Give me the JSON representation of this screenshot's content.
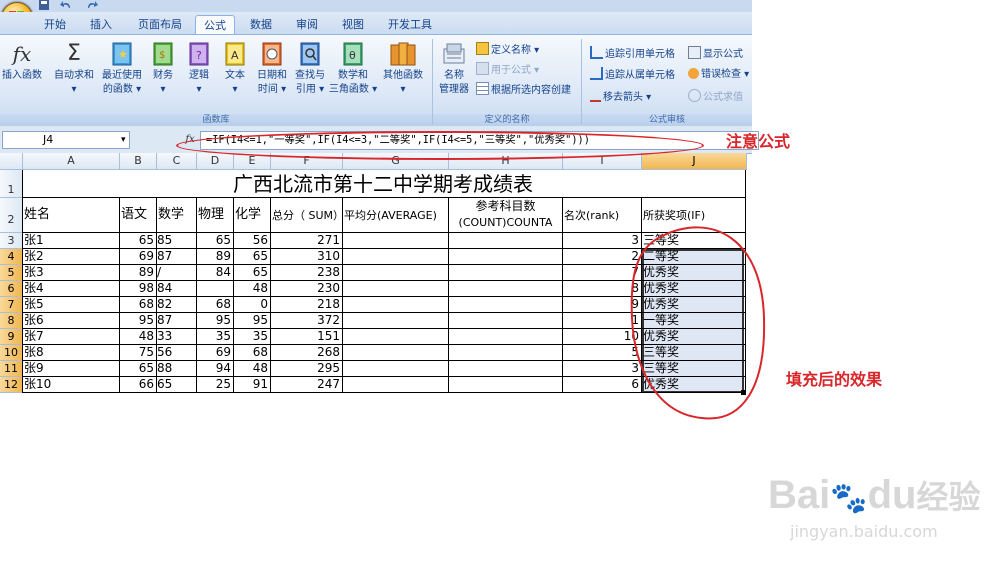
{
  "ribbon_tabs": [
    "开始",
    "插入",
    "页面布局",
    "公式",
    "数据",
    "审阅",
    "视图",
    "开发工具"
  ],
  "active_tab": "公式",
  "function_library": {
    "label": "函数库",
    "buttons": [
      {
        "line1": "插入函数",
        "line2": ""
      },
      {
        "line1": "自动求和",
        "line2": ""
      },
      {
        "line1": "最近使用",
        "line2": "的函数"
      },
      {
        "line1": "财务",
        "line2": ""
      },
      {
        "line1": "逻辑",
        "line2": ""
      },
      {
        "line1": "文本",
        "line2": ""
      },
      {
        "line1": "日期和",
        "line2": "时间"
      },
      {
        "line1": "查找与",
        "line2": "引用"
      },
      {
        "line1": "数学和",
        "line2": "三角函数"
      },
      {
        "line1": "其他函数",
        "line2": ""
      }
    ]
  },
  "defined_names": {
    "label": "定义的名称",
    "manager_line1": "名称",
    "manager_line2": "管理器",
    "define_name": "定义名称",
    "use_in_formula": "用于公式",
    "create_from_selection": "根据所选内容创建"
  },
  "formula_auditing": {
    "label": "公式审核",
    "trace_precedents": "追踪引用单元格",
    "trace_dependents": "追踪从属单元格",
    "remove_arrows": "移去箭头",
    "show_formulas": "显示公式",
    "error_checking": "错误检查",
    "evaluate_formula": "公式求值"
  },
  "name_box": "J4",
  "fx_label": "fx",
  "formula": "=IF(I4<=1,\"一等奖\",IF(I4<=3,\"二等奖\",IF(I4<=5,\"三等奖\",\"优秀奖\")))",
  "columns": [
    "A",
    "B",
    "C",
    "D",
    "E",
    "F",
    "G",
    "H",
    "I",
    "J"
  ],
  "selected_column": "J",
  "sheet": {
    "title": "广西北流市第十二中学期考成绩表",
    "headers": {
      "name": "姓名",
      "chinese": "语文",
      "math": "数学",
      "physics": "物理",
      "chemistry": "化学",
      "total": "总分（ SUM）",
      "average": "平均分(AVERAGE)",
      "subjects_line1": "参考科目数",
      "subjects_line2": "(COUNT)COUNTA",
      "rank": "名次(rank)",
      "award": "所获奖项(IF)"
    },
    "rows": [
      {
        "row": "3",
        "name": "张1",
        "b": "65",
        "c": "85",
        "d": "65",
        "e": "56",
        "f": "271",
        "i": "3",
        "j": "三等奖"
      },
      {
        "row": "4",
        "name": "张2",
        "b": "69",
        "c": "87",
        "d": "89",
        "e": "65",
        "f": "310",
        "i": "2",
        "j": "二等奖"
      },
      {
        "row": "5",
        "name": "张3",
        "b": "89",
        "c": "/",
        "d": "84",
        "e": "65",
        "f": "238",
        "i": "7",
        "j": "优秀奖"
      },
      {
        "row": "6",
        "name": "张4",
        "b": "98",
        "c": "84",
        "d": "",
        "e": "48",
        "f": "230",
        "i": "8",
        "j": "优秀奖"
      },
      {
        "row": "7",
        "name": "张5",
        "b": "68",
        "c": "82",
        "d": "68",
        "e": "0",
        "f": "218",
        "i": "9",
        "j": "优秀奖"
      },
      {
        "row": "8",
        "name": "张6",
        "b": "95",
        "c": "87",
        "d": "95",
        "e": "95",
        "f": "372",
        "i": "1",
        "j": "一等奖"
      },
      {
        "row": "9",
        "name": "张7",
        "b": "48",
        "c": "33",
        "d": "35",
        "e": "35",
        "f": "151",
        "i": "10",
        "j": "优秀奖"
      },
      {
        "row": "10",
        "name": "张8",
        "b": "75",
        "c": "56",
        "d": "69",
        "e": "68",
        "f": "268",
        "i": "5",
        "j": "三等奖"
      },
      {
        "row": "11",
        "name": "张9",
        "b": "65",
        "c": "88",
        "d": "94",
        "e": "48",
        "f": "295",
        "i": "3",
        "j": "三等奖"
      },
      {
        "row": "12",
        "name": "张10",
        "b": "66",
        "c": "65",
        "d": "25",
        "e": "91",
        "f": "247",
        "i": "6",
        "j": "优秀奖"
      }
    ]
  },
  "annotations": {
    "formula_note": "注意公式",
    "fill_note": "填充后的效果",
    "annotation_color": "#d8262a"
  },
  "watermark": {
    "brand": "Bai",
    "brand2": "du",
    "cn": "经验",
    "url": "jingyan.baidu.com"
  }
}
